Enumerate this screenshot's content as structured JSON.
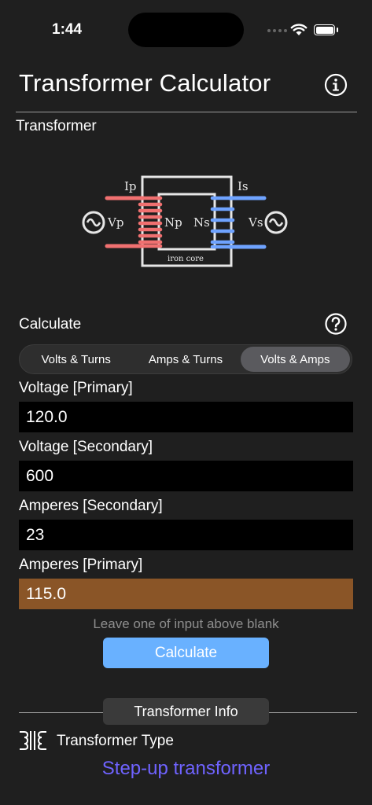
{
  "status_bar": {
    "time": "1:44"
  },
  "header": {
    "title": "Transformer Calculator"
  },
  "section": {
    "label": "Transformer"
  },
  "diagram": {
    "ip": "Ip",
    "is": "Is",
    "vp": "Vp",
    "vs": "Vs",
    "np": "Np",
    "ns": "Ns",
    "core": "iron core",
    "primary_color": "#f07070",
    "secondary_color": "#6fa3ff"
  },
  "calculate": {
    "label": "Calculate",
    "tabs": [
      "Volts & Turns",
      "Amps & Turns",
      "Volts & Amps"
    ],
    "active_tab": "Volts & Amps"
  },
  "fields": {
    "voltage_primary": {
      "label": "Voltage [Primary]",
      "value": "120.0"
    },
    "voltage_secondary": {
      "label": "Voltage [Secondary]",
      "value": "600"
    },
    "amperes_secondary": {
      "label": "Amperes [Secondary]",
      "value": "23"
    },
    "amperes_primary": {
      "label": "Amperes [Primary]",
      "value": "115.0"
    }
  },
  "hint": "Leave one of input above blank",
  "calc_button": "Calculate",
  "info": {
    "pill": "Transformer Info",
    "type_label": "Transformer Type",
    "type_value": "Step-up transformer"
  },
  "colors": {
    "accent_button": "#69b1ff",
    "result_field": "#8a5527",
    "type_value": "#6f63ff"
  }
}
